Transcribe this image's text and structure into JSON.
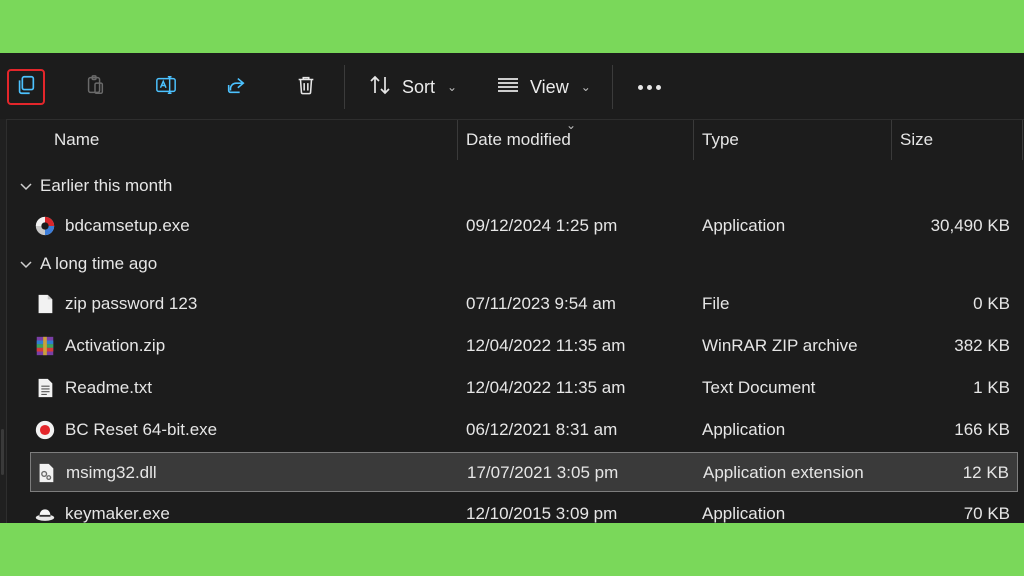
{
  "toolbar": {
    "copy_icon": "copy-icon",
    "paste_icon": "paste-icon",
    "rename_icon": "rename-icon",
    "share_icon": "share-icon",
    "delete_icon": "delete-icon",
    "sort_label": "Sort",
    "view_label": "View",
    "more_icon": "more-icon"
  },
  "columns": {
    "name": "Name",
    "date": "Date modified",
    "type": "Type",
    "size": "Size"
  },
  "groups": [
    {
      "label": "Earlier this month"
    },
    {
      "label": "A long time ago"
    }
  ],
  "files": [
    {
      "name": "bdcamsetup.exe",
      "date": "09/12/2024 1:25 pm",
      "type": "Application",
      "size": "30,490 KB",
      "icon": "bandicam-icon"
    },
    {
      "name": "zip password 123",
      "date": "07/11/2023 9:54 am",
      "type": "File",
      "size": "0 KB",
      "icon": "file-icon"
    },
    {
      "name": "Activation.zip",
      "date": "12/04/2022 11:35 am",
      "type": "WinRAR ZIP archive",
      "size": "382 KB",
      "icon": "winrar-icon"
    },
    {
      "name": "Readme.txt",
      "date": "12/04/2022 11:35 am",
      "type": "Text Document",
      "size": "1 KB",
      "icon": "text-file-icon"
    },
    {
      "name": "BC Reset 64-bit.exe",
      "date": "06/12/2021 8:31 am",
      "type": "Application",
      "size": "166 KB",
      "icon": "record-icon"
    },
    {
      "name": "msimg32.dll",
      "date": "17/07/2021 3:05 pm",
      "type": "Application extension",
      "size": "12 KB",
      "icon": "dll-file-icon",
      "selected": true
    },
    {
      "name": "keymaker.exe",
      "date": "12/10/2015 3:09 pm",
      "type": "Application",
      "size": "70 KB",
      "icon": "keymaker-icon"
    }
  ],
  "colors": {
    "background": "#7ad85a",
    "window": "#1c1c1c",
    "selected_outline": "#e3262b",
    "copy_icon": "#4cc2ff"
  }
}
